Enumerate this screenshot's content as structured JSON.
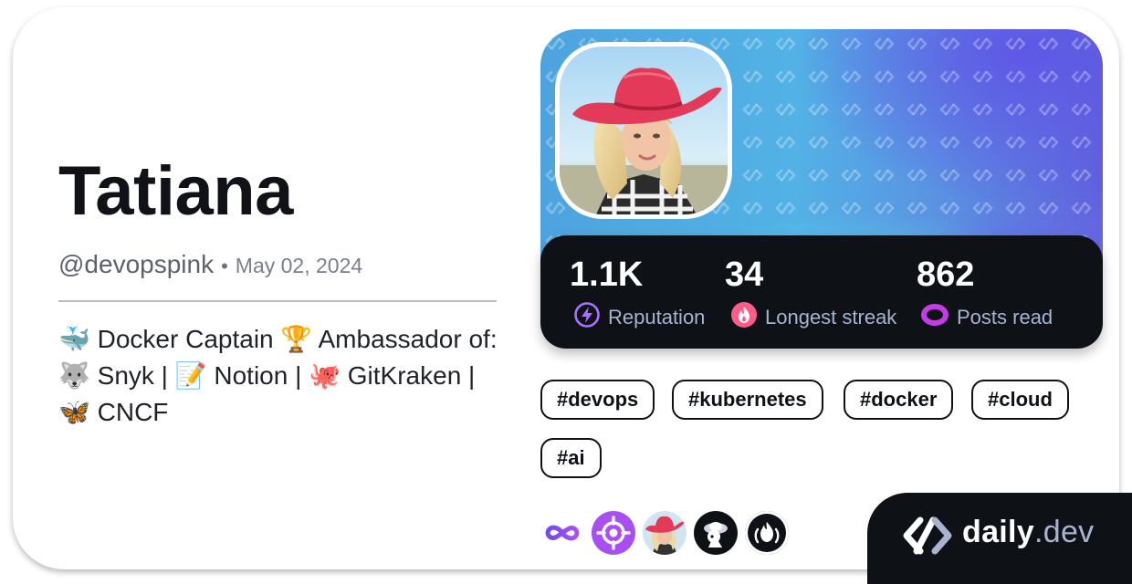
{
  "profile": {
    "name": "Tatiana",
    "handle": "@devopspink",
    "separator": "•",
    "joined_date": "May 02, 2024",
    "bio": "🐳 Docker Captain 🏆 Ambassador of: 🐺 Snyk | 📝 Notion | 🐙 GitKraken | 🦋 CNCF",
    "avatar_icon": "user-avatar-icon"
  },
  "stats": [
    {
      "value": "1.1K",
      "label": "Reputation",
      "icon": "reputation-icon",
      "color": "#a970ff"
    },
    {
      "value": "34",
      "label": "Longest streak",
      "icon": "streak-flame-icon",
      "color": "#ff5c8a"
    },
    {
      "value": "862",
      "label": "Posts read",
      "icon": "posts-read-icon",
      "color": "#c53ce6"
    }
  ],
  "tags": [
    "#devops",
    "#kubernetes",
    "#docker",
    "#cloud",
    "#ai"
  ],
  "badges": [
    {
      "name": "infinity-badge-icon",
      "color": "#8c4af0"
    },
    {
      "name": "target-badge-icon",
      "color": "#b24ef5"
    },
    {
      "name": "avatar-badge-icon",
      "color": "#f26288"
    },
    {
      "name": "astronaut-badge-icon",
      "color": "#0e1217"
    },
    {
      "name": "flame-badge-icon",
      "color": "#0e1217"
    }
  ],
  "brand": {
    "name": "daily",
    "suffix": ".dev",
    "icon": "daily-dev-logo-icon"
  },
  "colors": {
    "text_dark": "#101217",
    "stat_bar_bg": "#0e1217",
    "stat_label": "#a8b3cf",
    "hero_cyan": "#52b2e5",
    "hero_purple": "#5f58e6"
  }
}
